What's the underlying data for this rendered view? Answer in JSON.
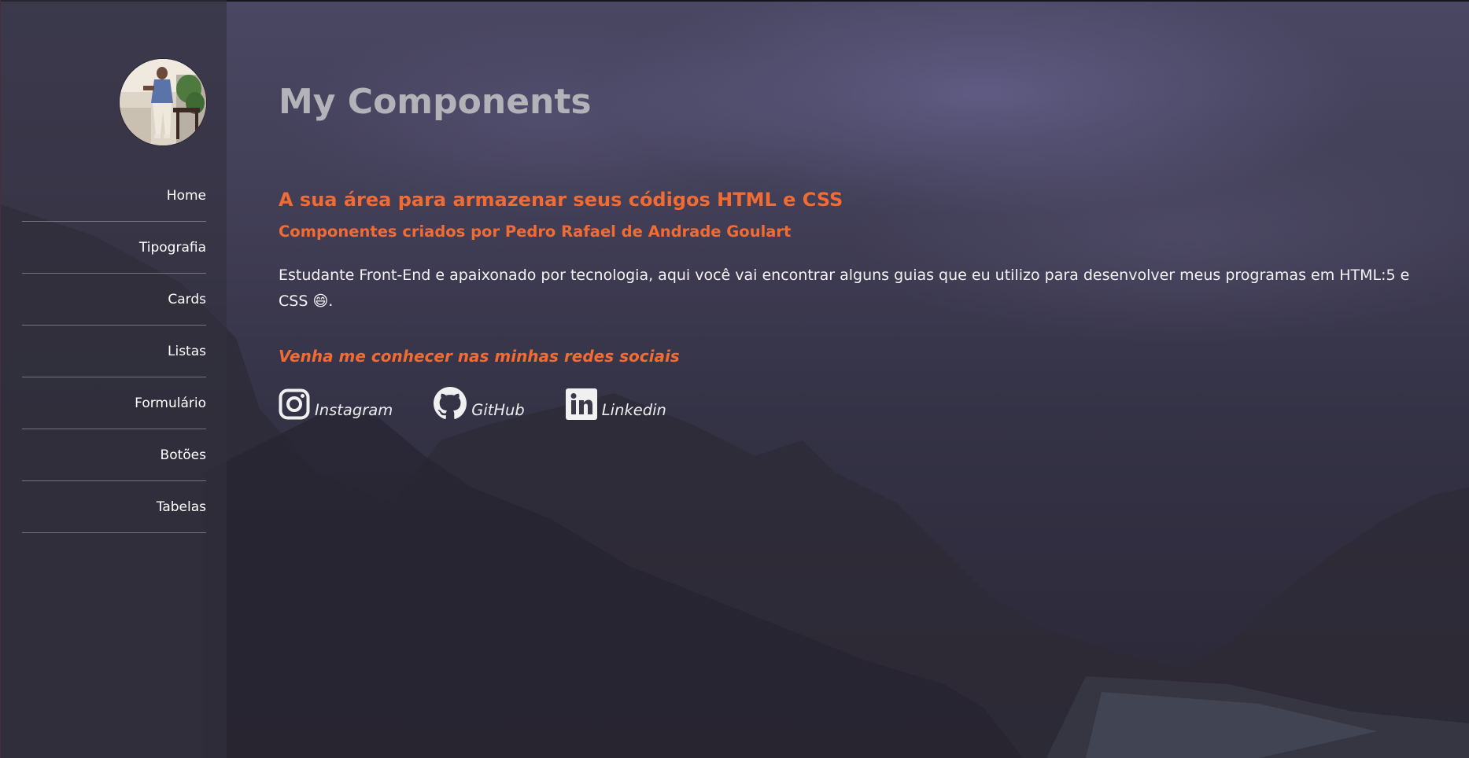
{
  "sidebar": {
    "avatar_alt": "avatar",
    "items": [
      {
        "label": "Home"
      },
      {
        "label": "Tipografia"
      },
      {
        "label": "Cards"
      },
      {
        "label": "Listas"
      },
      {
        "label": "Formulário"
      },
      {
        "label": "Botões"
      },
      {
        "label": "Tabelas"
      }
    ]
  },
  "main": {
    "title": "My Components",
    "heading": "A sua área para armazenar seus códigos HTML e CSS",
    "subheading": "Componentes criados por Pedro Rafael de Andrade Goulart",
    "description": "Estudante Front-End e apaixonado por tecnologia, aqui você vai encontrar alguns guias que eu utilizo para desenvolver meus programas em HTML:5 e CSS",
    "description_emoji": "😄",
    "description_end": ".",
    "social_heading": "Venha me conhecer nas minhas redes sociais",
    "social": [
      {
        "label": "Instagram",
        "icon": "instagram-icon"
      },
      {
        "label": "GitHub",
        "icon": "github-icon"
      },
      {
        "label": "Linkedin",
        "icon": "linkedin-icon"
      }
    ]
  },
  "colors": {
    "accent": "#f26b33",
    "title": "#b3b2b8",
    "text": "#f4f2f2"
  }
}
